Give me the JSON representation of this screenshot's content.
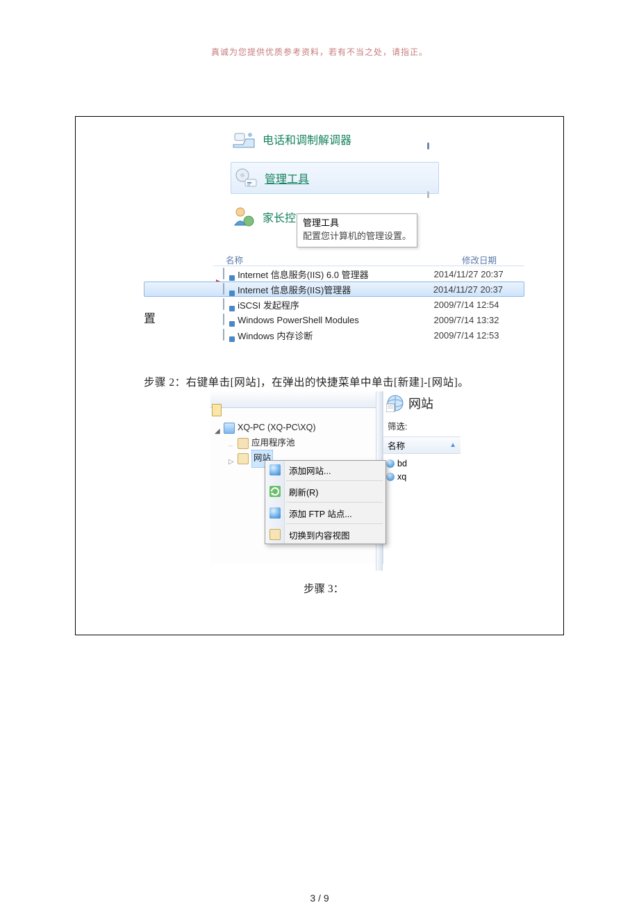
{
  "header_note": "真诚为您提供优质参考资料，若有不当之处，请指正。",
  "page_number": "3 / 9",
  "control_panel": {
    "items": [
      {
        "label": "电话和调制解调器",
        "icon": "phone-modem-icon"
      },
      {
        "label": "管理工具",
        "icon": "admin-tools-icon",
        "link": true
      },
      {
        "label": "家长控",
        "icon": "parental-icon"
      }
    ],
    "tooltip_title": "管理工具",
    "tooltip_body": "配置您计算机的管理设置。"
  },
  "admin_tools_list": {
    "col_name": "名称",
    "col_date": "修改日期",
    "left_fragment": "置",
    "rows": [
      {
        "name": "Internet 信息服务(IIS) 6.0 管理器",
        "date": "2014/11/27 20:37",
        "selected": false
      },
      {
        "name": "Internet 信息服务(IIS)管理器",
        "date": "2014/11/27 20:37",
        "selected": true
      },
      {
        "name": "iSCSI 发起程序",
        "date": "2009/7/14 12:54",
        "selected": false
      },
      {
        "name": "Windows PowerShell Modules",
        "date": "2009/7/14 13:32",
        "selected": false
      },
      {
        "name": "Windows 内存诊断",
        "date": "2009/7/14 12:53",
        "selected": false
      }
    ]
  },
  "paragraph_step2": "步骤 2：右键单击[网站]，在弹出的快捷菜单中单击[新建]-[网站]。",
  "iis": {
    "tree": {
      "server": "XQ-PC (XQ-PC\\XQ)",
      "app_pool": "应用程序池",
      "sites": "网站"
    },
    "right_pane": {
      "title": "网站",
      "filter_label": "筛选:",
      "col_name": "名称",
      "items": [
        {
          "name": "bd"
        },
        {
          "name": "xq"
        }
      ]
    },
    "context_menu": [
      {
        "label": "添加网站...",
        "icon": "globe-add-icon"
      },
      {
        "label": "刷新(R)",
        "icon": "refresh-icon"
      },
      {
        "label": "添加 FTP 站点...",
        "icon": "globe-ftp-icon"
      },
      {
        "label": "切换到内容视图",
        "icon": "switch-view-icon"
      }
    ]
  },
  "paragraph_step3": "步骤 3："
}
